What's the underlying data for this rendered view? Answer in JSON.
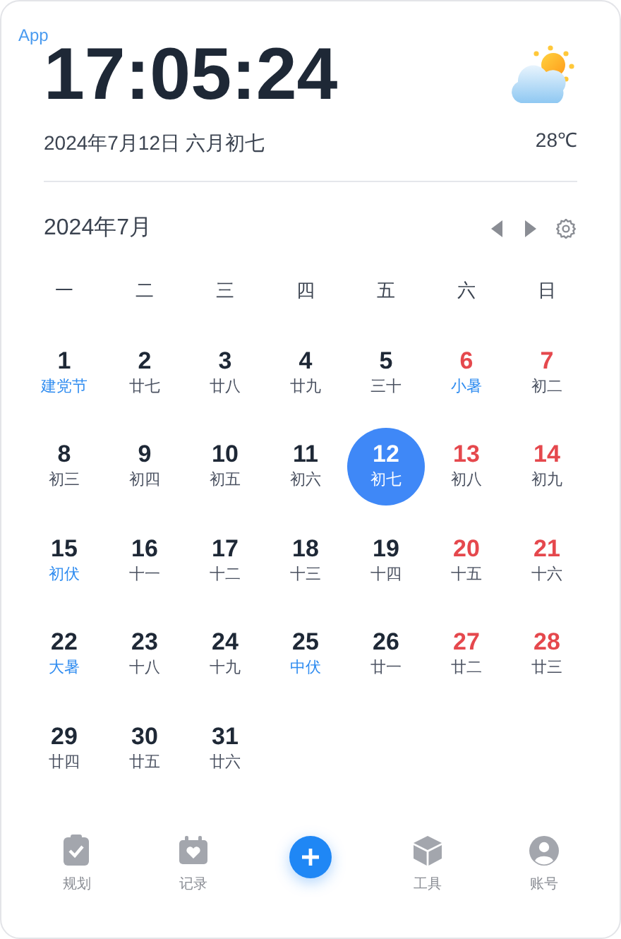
{
  "app_label": "App",
  "clock": {
    "time": "17:05:24",
    "date": "2024年7月12日 六月初七"
  },
  "weather": {
    "temperature": "28℃"
  },
  "calendar": {
    "month_title": "2024年7月",
    "weekdays": [
      "一",
      "二",
      "三",
      "四",
      "五",
      "六",
      "日"
    ],
    "days": [
      {
        "day": "1",
        "lunar": "建党节",
        "weekend": false,
        "festival": true,
        "selected": false
      },
      {
        "day": "2",
        "lunar": "廿七",
        "weekend": false,
        "festival": false,
        "selected": false
      },
      {
        "day": "3",
        "lunar": "廿八",
        "weekend": false,
        "festival": false,
        "selected": false
      },
      {
        "day": "4",
        "lunar": "廿九",
        "weekend": false,
        "festival": false,
        "selected": false
      },
      {
        "day": "5",
        "lunar": "三十",
        "weekend": false,
        "festival": false,
        "selected": false
      },
      {
        "day": "6",
        "lunar": "小暑",
        "weekend": true,
        "festival": true,
        "selected": false
      },
      {
        "day": "7",
        "lunar": "初二",
        "weekend": true,
        "festival": false,
        "selected": false
      },
      {
        "day": "8",
        "lunar": "初三",
        "weekend": false,
        "festival": false,
        "selected": false
      },
      {
        "day": "9",
        "lunar": "初四",
        "weekend": false,
        "festival": false,
        "selected": false
      },
      {
        "day": "10",
        "lunar": "初五",
        "weekend": false,
        "festival": false,
        "selected": false
      },
      {
        "day": "11",
        "lunar": "初六",
        "weekend": false,
        "festival": false,
        "selected": false
      },
      {
        "day": "12",
        "lunar": "初七",
        "selected": true
      },
      {
        "day": "13",
        "lunar": "初八",
        "weekend": true,
        "festival": false,
        "selected": false
      },
      {
        "day": "14",
        "lunar": "初九",
        "weekend": true,
        "festival": false,
        "selected": false
      },
      {
        "day": "15",
        "lunar": "初伏",
        "weekend": false,
        "festival": true,
        "selected": false
      },
      {
        "day": "16",
        "lunar": "十一",
        "weekend": false,
        "festival": false,
        "selected": false
      },
      {
        "day": "17",
        "lunar": "十二",
        "weekend": false,
        "festival": false,
        "selected": false
      },
      {
        "day": "18",
        "lunar": "十三",
        "weekend": false,
        "festival": false,
        "selected": false
      },
      {
        "day": "19",
        "lunar": "十四",
        "weekend": false,
        "festival": false,
        "selected": false
      },
      {
        "day": "20",
        "lunar": "十五",
        "weekend": true,
        "festival": false,
        "selected": false
      },
      {
        "day": "21",
        "lunar": "十六",
        "weekend": true,
        "festival": false,
        "selected": false
      },
      {
        "day": "22",
        "lunar": "大暑",
        "weekend": false,
        "festival": true,
        "selected": false
      },
      {
        "day": "23",
        "lunar": "十八",
        "weekend": false,
        "festival": false,
        "selected": false
      },
      {
        "day": "24",
        "lunar": "十九",
        "weekend": false,
        "festival": false,
        "selected": false
      },
      {
        "day": "25",
        "lunar": "中伏",
        "weekend": false,
        "festival": true,
        "selected": false
      },
      {
        "day": "26",
        "lunar": "廿一",
        "weekend": false,
        "festival": false,
        "selected": false
      },
      {
        "day": "27",
        "lunar": "廿二",
        "weekend": true,
        "festival": false,
        "selected": false
      },
      {
        "day": "28",
        "lunar": "廿三",
        "weekend": true,
        "festival": false,
        "selected": false
      },
      {
        "day": "29",
        "lunar": "廿四",
        "weekend": false,
        "festival": false,
        "selected": false
      },
      {
        "day": "30",
        "lunar": "廿五",
        "weekend": false,
        "festival": false,
        "selected": false
      },
      {
        "day": "31",
        "lunar": "廿六",
        "weekend": false,
        "festival": false,
        "selected": false
      }
    ]
  },
  "nav": [
    {
      "kind": "plan",
      "label": "规划"
    },
    {
      "kind": "record",
      "label": "记录"
    },
    {
      "kind": "add"
    },
    {
      "kind": "tools",
      "label": "工具"
    },
    {
      "kind": "account",
      "label": "账号"
    }
  ]
}
